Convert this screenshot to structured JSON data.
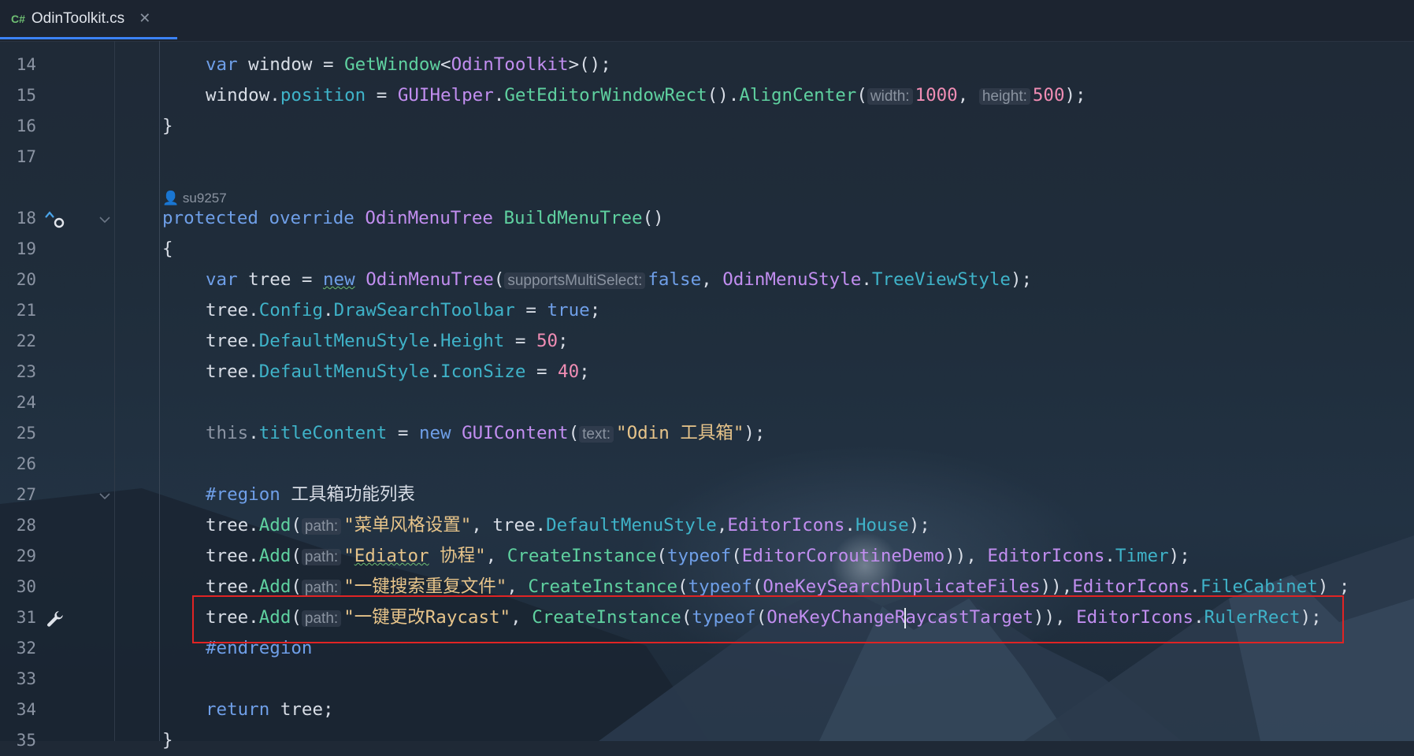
{
  "tab": {
    "lang_badge": "C#",
    "file_name": "OdinToolkit.cs",
    "close_glyph": "✕"
  },
  "gutter": {
    "line_numbers": [
      "14",
      "15",
      "16",
      "17",
      "18",
      "19",
      "20",
      "21",
      "22",
      "23",
      "24",
      "25",
      "26",
      "27",
      "28",
      "29",
      "30",
      "31",
      "32",
      "33",
      "34",
      "35"
    ],
    "icons": {
      "line18": "override-implemented-icon",
      "line31": "wrench-icon"
    }
  },
  "code_author": "su9257",
  "code": {
    "l14": {
      "kw": "var",
      "t1": " window = ",
      "fn": "GetWindow",
      "t2": "<",
      "ty": "OdinToolkit",
      "t3": ">();"
    },
    "l15": {
      "t1": "window.",
      "prop": "position",
      "t2": " = ",
      "ty": "GUIHelper",
      "t3": ".",
      "fn1": "GetEditorWindowRect",
      "t4": "().",
      "fn2": "AlignCenter",
      "t5": "(",
      "hint1": "width:",
      "num1": "1000",
      "t6": ", ",
      "hint2": "height:",
      "num2": "500",
      "t7": ");"
    },
    "l16": {
      "t": "}"
    },
    "l18": {
      "kw1": "protected",
      "kw2": "override",
      "ty": "OdinMenuTree",
      "fn": "BuildMenuTree",
      "t": "()"
    },
    "l19": {
      "t": "{"
    },
    "l20": {
      "kw": "var",
      "t1": " tree = ",
      "kw2": "new",
      "ty": "OdinMenuTree",
      "t2": "(",
      "hint": "supportsMultiSelect:",
      "kw3": "false",
      "t3": ", ",
      "ty2": "OdinMenuStyle",
      "t4": ".",
      "prop": "TreeViewStyle",
      "t5": ");"
    },
    "l21": {
      "t1": "tree.",
      "p1": "Config",
      "t2": ".",
      "p2": "DrawSearchToolbar",
      "t3": " = ",
      "kw": "true",
      "t4": ";"
    },
    "l22": {
      "t1": "tree.",
      "p1": "DefaultMenuStyle",
      "t2": ".",
      "p2": "Height",
      "t3": " = ",
      "num": "50",
      "t4": ";"
    },
    "l23": {
      "t1": "tree.",
      "p1": "DefaultMenuStyle",
      "t2": ".",
      "p2": "IconSize",
      "t3": " = ",
      "num": "40",
      "t4": ";"
    },
    "l25": {
      "kw": "this",
      "t1": ".",
      "p": "titleContent",
      "t2": " = ",
      "kw2": "new",
      "ty": "GUIContent",
      "t3": "(",
      "hint": "text:",
      "str": "\"Odin 工具箱\"",
      "t4": ");"
    },
    "l27": {
      "reg": "#region",
      "t": " 工具箱功能列表"
    },
    "l28": {
      "t1": "tree.",
      "fn": "Add",
      "t2": "(",
      "hint": "path:",
      "str": "\"菜单风格设置\"",
      "t3": ", tree.",
      "p1": "DefaultMenuStyle",
      "t4": ",",
      "ty": "EditorIcons",
      "t5": ".",
      "p2": "House",
      "t6": ");"
    },
    "l29": {
      "t1": "tree.",
      "fn": "Add",
      "t2": "(",
      "hint": "path:",
      "str1": "\"",
      "str2": "Ediator",
      "str3": " 协程\"",
      "t3": ", ",
      "fn2": "CreateInstance",
      "t4": "(",
      "kw": "typeof",
      "t5": "(",
      "ty": "EditorCoroutineDemo",
      "t6": ")), ",
      "ty2": "EditorIcons",
      "t7": ".",
      "p": "Timer",
      "t8": ");"
    },
    "l30": {
      "t1": "tree.",
      "fn": "Add",
      "t2": "(",
      "hint": "path:",
      "str": "\"一键搜索重复文件\"",
      "t3": ", ",
      "fn2": "CreateInstance",
      "t4": "(",
      "kw": "typeof",
      "t5": "(",
      "ty": "OneKeySearchDuplicateFiles",
      "t6": ")),",
      "ty2": "EditorIcons",
      "t7": ".",
      "p": "FileCabinet",
      "t8": ") ;"
    },
    "l31": {
      "t1": "tree.",
      "fn": "Add",
      "t2": "(",
      "hint": "path:",
      "str1": "\"一键更改",
      "str2": "Raycast\"",
      "t3": ", ",
      "fn2": "CreateInstance",
      "t4": "(",
      "kw": "typeof",
      "t5": "(",
      "ty_a": "OneKeyChangeR",
      "ty_b": "aycastTarget",
      "t6": ")), ",
      "ty2": "EditorIcons",
      "t7": ".",
      "p": "RulerRect",
      "t8": ");"
    },
    "l32": {
      "reg": "#endregion"
    },
    "l34": {
      "kw": "return",
      "t": " tree;"
    },
    "l35": {
      "t": "}"
    }
  },
  "colors": {
    "accent": "#3b82f6",
    "highlight_box": "#e02424"
  }
}
